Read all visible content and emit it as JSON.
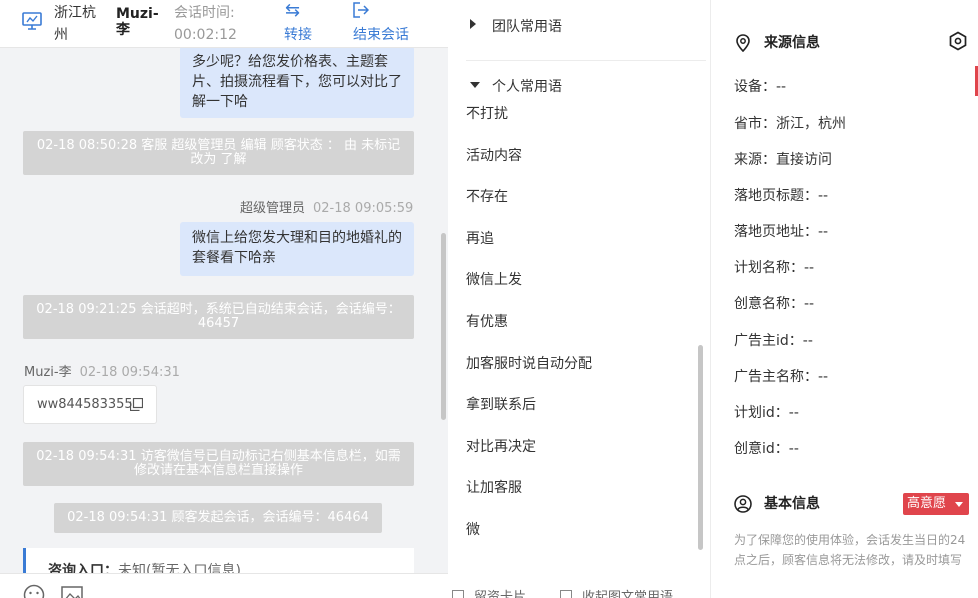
{
  "header": {
    "location": "浙江杭州",
    "customer_name": "Muzi-李",
    "session_time_label": "会话时间:",
    "session_time_value": "00:02:12",
    "transfer_label": "转接",
    "end_label": "结束会话"
  },
  "messages": {
    "agent_bubble_1": "多少呢？给您发价格表、主题套片、拍摄流程看下，您可以对比了解一下哈",
    "system_1": "02-18 08:50:28 客服 超级管理员 编辑 顾客状态 ： 由 未标记 改为 了解",
    "agent_meta_name": "超级管理员",
    "agent_meta_time": "02-18 09:05:59",
    "agent_bubble_2": "微信上给您发大理和目的地婚礼的套餐看下哈亲",
    "system_2": "02-18 09:21:25 会话超时，系统已自动结束会话，会话编号：46457",
    "visitor_meta_name": "Muzi-李",
    "visitor_meta_time": "02-18 09:54:31",
    "visitor_copy_text": "ww844583355",
    "system_3": "02-18 09:54:31 访客微信号已自动标记右侧基本信息栏，如需修改请在基本信息栏直接操作",
    "system_4": "02-18 09:54:31 顾客发起会话，会话编号：46464",
    "entry_label": "咨询入口：",
    "entry_value": "未知(暂无入口信息)"
  },
  "phrases": {
    "team_group": "团队常用语",
    "personal_group": "个人常用语",
    "items": [
      "不打扰",
      "活动内容",
      "不存在",
      "再追",
      "微信上发",
      "有优惠",
      "加客服时说自动分配",
      "拿到联系后",
      "对比再决定",
      "让加客服",
      "微"
    ],
    "footer_card": "留资卡片",
    "footer_collect": "收起图文常用语"
  },
  "source_info": {
    "title": "来源信息",
    "rows": [
      "设备：--",
      "省市：浙江，杭州",
      "来源：直接访问",
      "落地页标题：--",
      "落地页地址：--",
      "计划名称：--",
      "创意名称：--",
      "广告主id：--",
      "广告主名称：--",
      "计划id：--",
      "创意id：--"
    ]
  },
  "basic_info": {
    "title": "基本信息",
    "intent_tag": "高意愿",
    "note": "为了保障您的使用体验，会话发生当日的24点之后，顾客信息将无法修改，请及时填写"
  },
  "colors": {
    "accent": "#3a7bd5",
    "agent_bubble": "#dbe7fb",
    "system_msg": "#d4d4d4",
    "intent_tag": "#e0454c"
  }
}
